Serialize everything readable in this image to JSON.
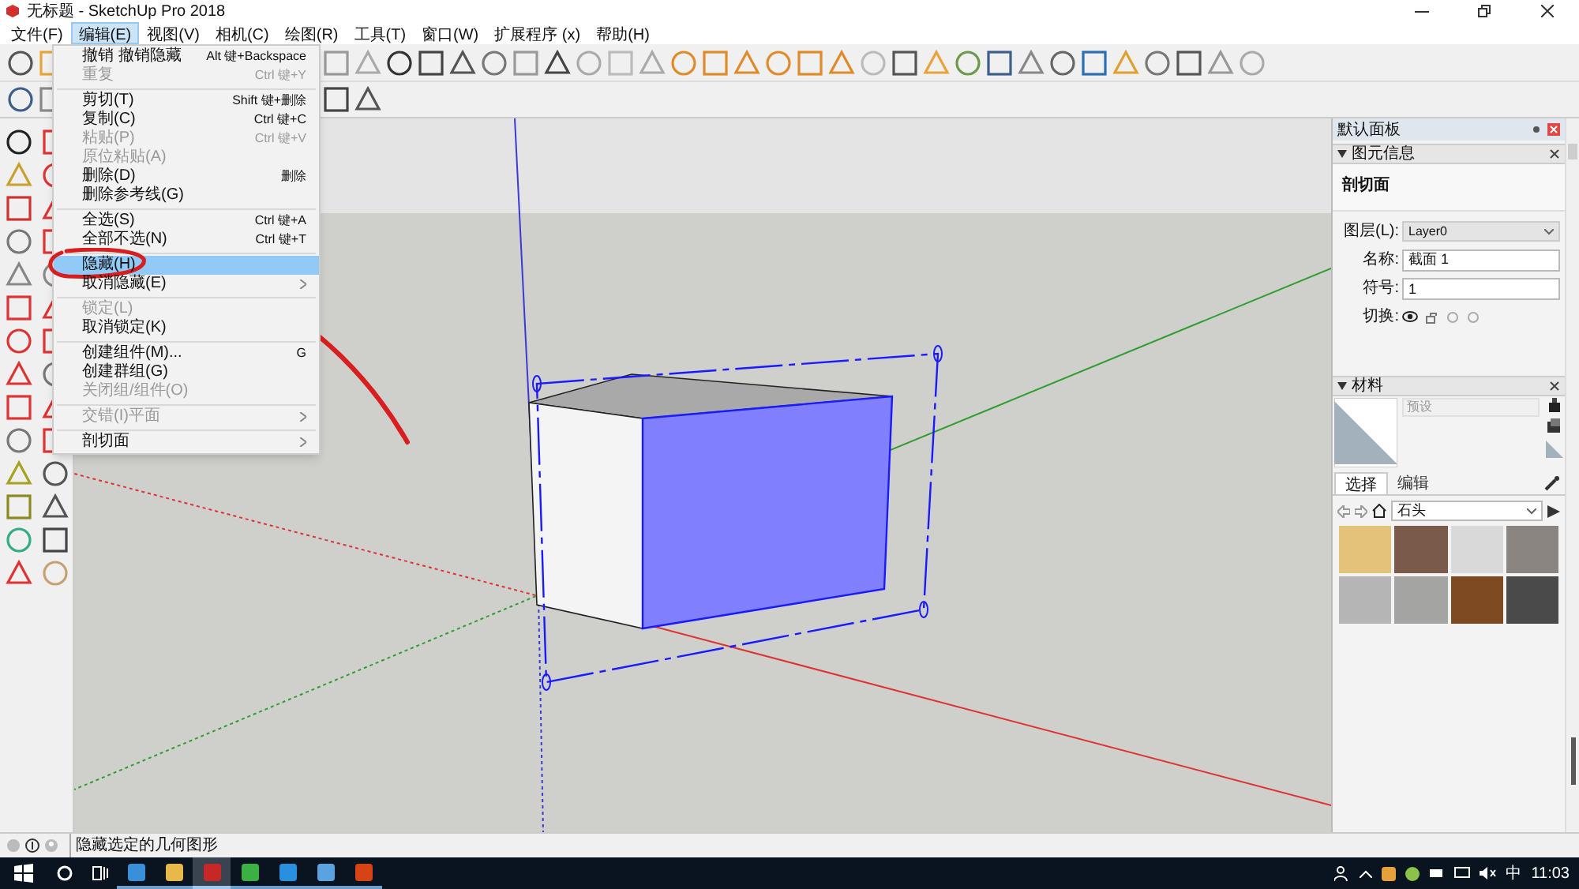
{
  "window": {
    "title": "无标题 - SketchUp Pro 2018"
  },
  "menu_bar": [
    {
      "label": "文件(F)",
      "selected": false
    },
    {
      "label": "编辑(E)",
      "selected": true
    },
    {
      "label": "视图(V)",
      "selected": false
    },
    {
      "label": "相机(C)",
      "selected": false
    },
    {
      "label": "绘图(R)",
      "selected": false
    },
    {
      "label": "工具(T)",
      "selected": false
    },
    {
      "label": "窗口(W)",
      "selected": false
    },
    {
      "label": "扩展程序 (x)",
      "selected": false
    },
    {
      "label": "帮助(H)",
      "selected": false
    }
  ],
  "edit_menu": [
    {
      "kind": "item",
      "label": "撤销 撤销隐藏",
      "shortcut": "Alt 键+Backspace",
      "disabled": false,
      "selected": false,
      "submenu": false
    },
    {
      "kind": "item",
      "label": "重复",
      "shortcut": "Ctrl 键+Y",
      "disabled": true,
      "selected": false,
      "submenu": false
    },
    {
      "kind": "separator"
    },
    {
      "kind": "item",
      "label": "剪切(T)",
      "shortcut": "Shift 键+删除",
      "disabled": false,
      "selected": false,
      "submenu": false
    },
    {
      "kind": "item",
      "label": "复制(C)",
      "shortcut": "Ctrl 键+C",
      "disabled": false,
      "selected": false,
      "submenu": false
    },
    {
      "kind": "item",
      "label": "粘贴(P)",
      "shortcut": "Ctrl 键+V",
      "disabled": true,
      "selected": false,
      "submenu": false
    },
    {
      "kind": "item",
      "label": "原位粘贴(A)",
      "disabled": true,
      "selected": false,
      "submenu": false
    },
    {
      "kind": "item",
      "label": "删除(D)",
      "shortcut": "删除",
      "disabled": false,
      "selected": false,
      "submenu": false
    },
    {
      "kind": "item",
      "label": "删除参考线(G)",
      "disabled": false,
      "selected": false,
      "submenu": false
    },
    {
      "kind": "separator"
    },
    {
      "kind": "item",
      "label": "全选(S)",
      "shortcut": "Ctrl 键+A",
      "disabled": false,
      "selected": false,
      "submenu": false
    },
    {
      "kind": "item",
      "label": "全部不选(N)",
      "shortcut": "Ctrl 键+T",
      "disabled": false,
      "selected": false,
      "submenu": false
    },
    {
      "kind": "separator"
    },
    {
      "kind": "item",
      "label": "隐藏(H)",
      "disabled": false,
      "selected": true,
      "submenu": false
    },
    {
      "kind": "item",
      "label": "取消隐藏(E)",
      "disabled": false,
      "selected": false,
      "submenu": true
    },
    {
      "kind": "separator"
    },
    {
      "kind": "item",
      "label": "锁定(L)",
      "disabled": true,
      "selected": false,
      "submenu": false
    },
    {
      "kind": "item",
      "label": "取消锁定(K)",
      "disabled": false,
      "selected": false,
      "submenu": false
    },
    {
      "kind": "separator"
    },
    {
      "kind": "item",
      "label": "创建组件(M)...",
      "shortcut": "G",
      "disabled": false,
      "selected": false,
      "submenu": false
    },
    {
      "kind": "item",
      "label": "创建群组(G)",
      "disabled": false,
      "selected": false,
      "submenu": false
    },
    {
      "kind": "item",
      "label": "关闭组/组件(O)",
      "disabled": true,
      "selected": false,
      "submenu": false
    },
    {
      "kind": "separator"
    },
    {
      "kind": "item",
      "label": "交错(I)平面",
      "disabled": true,
      "selected": false,
      "submenu": true
    },
    {
      "kind": "separator"
    },
    {
      "kind": "item",
      "label": "剖切面",
      "disabled": false,
      "selected": false,
      "submenu": true
    }
  ],
  "tray": {
    "title": "默认面板",
    "entity_info": {
      "header": "图元信息",
      "entity": "剖切面",
      "layer_label": "图层(L):",
      "layer": "Layer0",
      "name_label": "名称:",
      "name": "截面 1",
      "symbol_label": "符号:",
      "symbol": "1",
      "toggle_label": "切换:"
    },
    "materials": {
      "header": "材料",
      "placeholder": "预设",
      "tabs": [
        {
          "label": "选择",
          "selected": true
        },
        {
          "label": "编辑",
          "selected": false
        }
      ],
      "library": "石头"
    }
  },
  "status_bar": {
    "text": "隐藏选定的几何图形"
  },
  "taskbar": {
    "ime": "中",
    "time": "11:03"
  }
}
